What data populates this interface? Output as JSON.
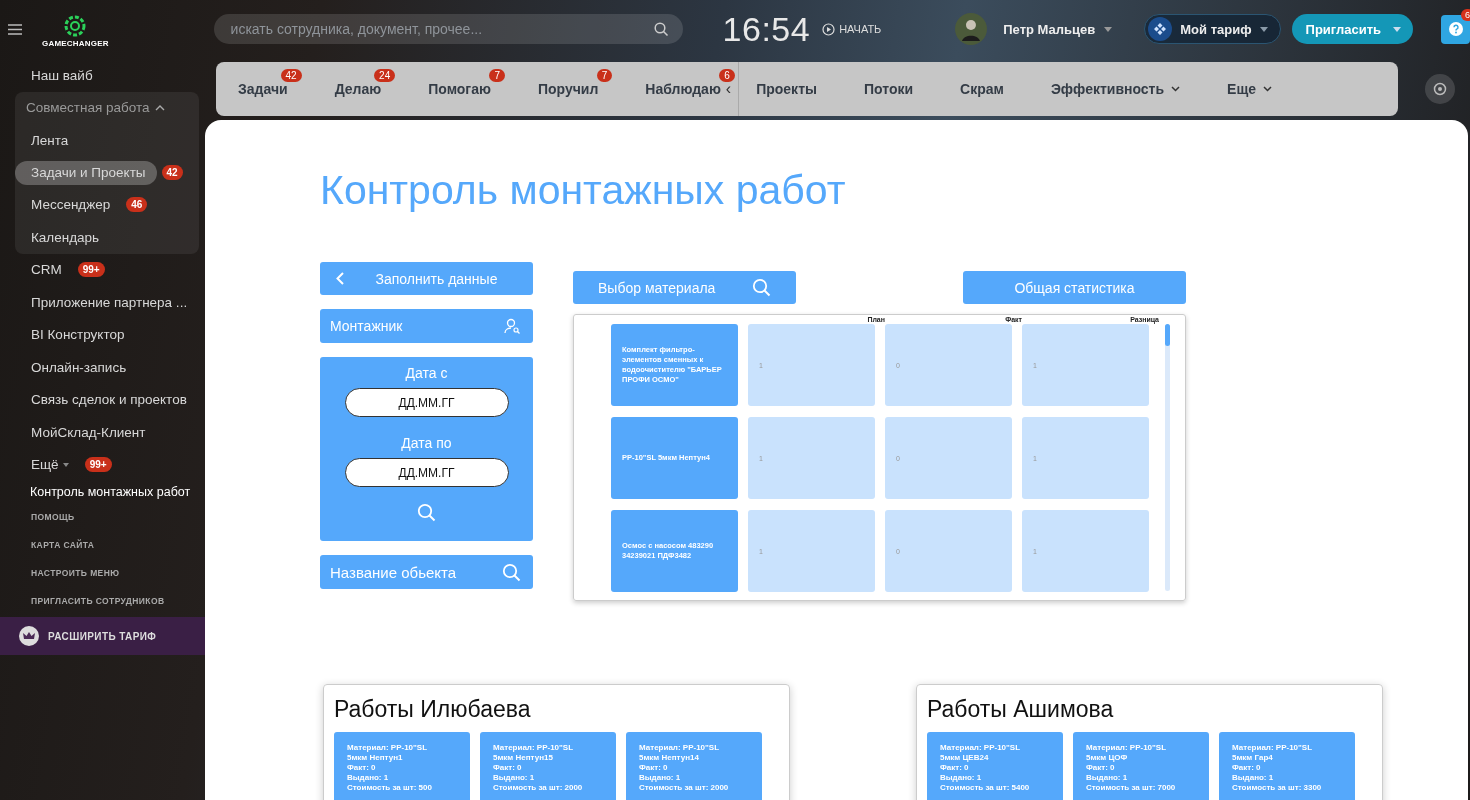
{
  "header": {
    "logo": "GAMECHANGER",
    "search": {
      "placeholder": "искать сотрудника, документ, прочее..."
    },
    "clock": "16:54",
    "start": "НАЧАТЬ",
    "user": "Петр Мальцев",
    "tariff": "Мой тариф",
    "invite": "Пригласить",
    "help_badge": "6"
  },
  "sidebar": {
    "items": [
      {
        "kind": "link",
        "label": "Наш вайб",
        "selected": false
      },
      {
        "kind": "group",
        "label": "Совместная работа",
        "expanded": true,
        "children": [
          {
            "label": "Лента",
            "selected": false
          },
          {
            "label": "Задачи и Проекты",
            "selected": true,
            "badge": "42"
          },
          {
            "label": "Мессенджер",
            "selected": false,
            "badge": "46"
          },
          {
            "label": "Календарь",
            "selected": false
          }
        ]
      },
      {
        "kind": "link",
        "label": "CRM",
        "selected": false,
        "badge": "99+"
      },
      {
        "kind": "link",
        "label": "Приложение партнера ...",
        "selected": false
      },
      {
        "kind": "link",
        "label": "BI Конструктор",
        "selected": false
      },
      {
        "kind": "link",
        "label": "Онлайн-запись",
        "selected": false
      },
      {
        "kind": "link",
        "label": "Связь сделок и проектов",
        "selected": false
      },
      {
        "kind": "link",
        "label": "МойСклад-Клиент",
        "selected": false
      },
      {
        "kind": "more",
        "label": "Ещё",
        "selected": false,
        "badge": "99+"
      },
      {
        "kind": "link",
        "label": "Контроль монтажных работ",
        "selected": true
      },
      {
        "kind": "small",
        "label": "ПОМОЩЬ"
      },
      {
        "kind": "small",
        "label": "КАРТА САЙТА"
      },
      {
        "kind": "small",
        "label": "НАСТРОИТЬ МЕНЮ"
      },
      {
        "kind": "small",
        "label": "ПРИГЛАСИТЬ СОТРУДНИКОВ"
      }
    ],
    "upgrade": "РАСШИРИТЬ ТАРИФ"
  },
  "tabs": [
    {
      "label": "Задачи",
      "badge": "42"
    },
    {
      "label": "Делаю",
      "badge": "24"
    },
    {
      "label": "Помогаю",
      "badge": "7"
    },
    {
      "label": "Поручил",
      "badge": "7"
    },
    {
      "label": "Наблюдаю",
      "badge": "6"
    }
  ],
  "tabs_collapse": "‹",
  "tabs_more": [
    {
      "label": "Проекты",
      "dropdown": false
    },
    {
      "label": "Потоки",
      "dropdown": false
    },
    {
      "label": "Скрам",
      "dropdown": false
    },
    {
      "label": "Эффективность",
      "dropdown": true
    },
    {
      "label": "Еще",
      "dropdown": true
    }
  ],
  "page": {
    "title": "Контроль монтажных работ",
    "fill_button": "Заполнить данные",
    "installer_field": {
      "placeholder": "Монтажник"
    },
    "date_from": {
      "label": "Дата с",
      "placeholder": "ДД.ММ.ГГ"
    },
    "date_to": {
      "label": "Дата по",
      "placeholder": "ДД.ММ.ГГ"
    },
    "object_field": {
      "placeholder": "Название обьекта"
    },
    "material_button": "Выбор материала",
    "stats_button": "Общая статистика",
    "table": {
      "columns": [
        "План",
        "Факт",
        "Разница"
      ],
      "rows": [
        {
          "name": "Комплект фильтро-элементов сменных к водоочистителю \"БАРЬЕР ПРОФИ ОСМО\"",
          "plan": "1",
          "fact": "0",
          "diff": "1"
        },
        {
          "name": "PP-10\"SL 5мкм Нептун4",
          "plan": "1",
          "fact": "0",
          "diff": "1"
        },
        {
          "name": "Осмос с насосом 483290 34239021 ПДФ3482",
          "plan": "1",
          "fact": "0",
          "diff": "1"
        }
      ]
    },
    "works": [
      {
        "title": "Работы Илюбаева",
        "cards": [
          {
            "material": "Материал: PP-10\"SL 5мкм Нептун1",
            "fact": "Факт: 0",
            "issued": "Выдано: 1",
            "cost": "Стоимость за шт: 500"
          },
          {
            "material": "Материал: PP-10\"SL 5мкм Нептун15",
            "fact": "Факт: 0",
            "issued": "Выдано: 1",
            "cost": "Стоимость за шт: 2000"
          },
          {
            "material": "Материал: PP-10\"SL 5мкм Нептун14",
            "fact": "Факт: 0",
            "issued": "Выдано: 1",
            "cost": "Стоимость за шт: 2000"
          }
        ]
      },
      {
        "title": "Работы Ашимова",
        "cards": [
          {
            "material": "Материал: PP-10\"SL 5мкм ЦЕВ24",
            "fact": "Факт: 0",
            "issued": "Выдано: 1",
            "cost": "Стоимость за шт: 5400"
          },
          {
            "material": "Материал: PP-10\"SL 5мкм ЦОФ",
            "fact": "Факт: 0",
            "issued": "Выдано: 1",
            "cost": "Стоимость за шт: 7000"
          },
          {
            "material": "Материал: PP-10\"SL 5мкм Гар4",
            "fact": "Факт: 0",
            "issued": "Выдано: 1",
            "cost": "Стоимость за шт: 3300"
          }
        ]
      }
    ]
  }
}
